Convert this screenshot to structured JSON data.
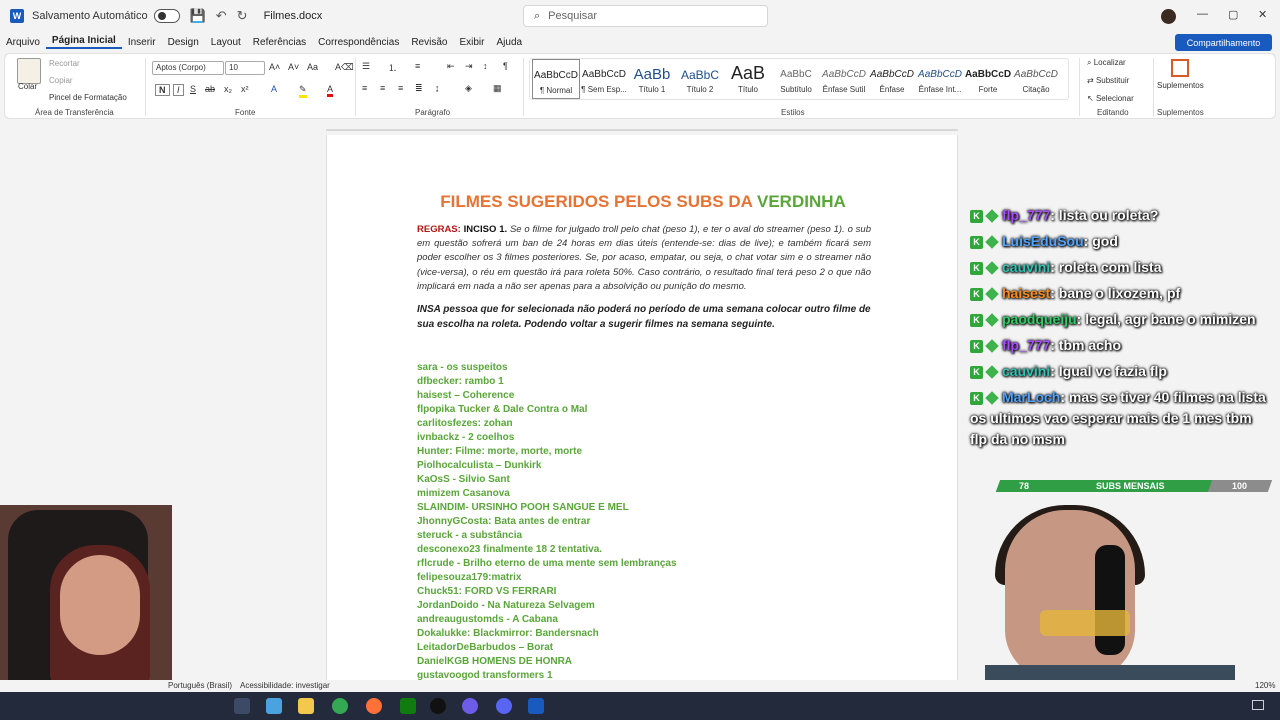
{
  "titlebar": {
    "autosave_label": "Salvamento Automático",
    "filename": "Filmes.docx",
    "search_placeholder": "Pesquisar"
  },
  "ribbon_tabs": [
    "Arquivo",
    "Página Inicial",
    "Inserir",
    "Design",
    "Layout",
    "Referências",
    "Correspondências",
    "Revisão",
    "Exibir",
    "Ajuda"
  ],
  "share_label": "Compartilhamento",
  "clipboard": {
    "paste": "Colar",
    "cut": "Recortar",
    "copy": "Copiar",
    "format_painter": "Pincel de Formatação",
    "group": "Área de Transferência"
  },
  "font": {
    "family": "Aptos (Corpo)",
    "size": "10",
    "group": "Fonte"
  },
  "paragraph_group": "Parágrafo",
  "styles": {
    "group": "Estilos",
    "items": [
      {
        "preview": "AaBbCcD",
        "name": "¶ Normal"
      },
      {
        "preview": "AaBbCcD",
        "name": "¶ Sem Esp..."
      },
      {
        "preview": "AaBb",
        "name": "Título 1"
      },
      {
        "preview": "AaBbC",
        "name": "Título 2"
      },
      {
        "preview": "AaB",
        "name": "Título"
      },
      {
        "preview": "AaBbC",
        "name": "Subtítulo"
      },
      {
        "preview": "AaBbCcD",
        "name": "Ênfase Sutil"
      },
      {
        "preview": "AaBbCcD",
        "name": "Ênfase"
      },
      {
        "preview": "AaBbCcD",
        "name": "Ênfase Int..."
      },
      {
        "preview": "AaBbCcD",
        "name": "Forte"
      },
      {
        "preview": "AaBbCcD",
        "name": "Citação"
      }
    ]
  },
  "editing": {
    "find": "Localizar",
    "replace": "Substituir",
    "select": "Selecionar",
    "group": "Editando"
  },
  "addins": {
    "label": "Suplementos",
    "group": "Suplementos"
  },
  "document": {
    "title_main": "FILMES SUGERIDOS PELOS SUBS DA",
    "title_accent": "VERDINHA",
    "rules_label": "REGRAS:",
    "rules_clause": "INCISO 1.",
    "rules_text": "Se o filme for julgado troll pelo chat (peso 1), e ter o aval do streamer (peso 1). o sub em questão sofrerá um ban de 24 horas em dias úteis (entende-se: dias de live); e também ficará sem poder escolher os 3 filmes posteriores. Se, por acaso, empatar, ou seja, o chat votar sim e o streamer não (vice-versa), o réu em questão irá para roleta 50%. Caso contrário, o resultado final terá peso 2 o que não implicará em nada a não ser apenas para a absolvição ou punição do mesmo.",
    "rule2": "INSA pessoa que for selecionada não poderá no período de uma semana colocar outro filme de sua escolha na roleta. Podendo voltar a sugerir filmes na semana seguinte.",
    "list": [
      "sara - os suspeitos",
      "dfbecker: rambo 1",
      "haisest – Coherence",
      "flpopika Tucker & Dale Contra o Mal",
      "carlitosfezes: zohan",
      "ivnbackz - 2 coelhos",
      "Hunter: Filme: morte, morte, morte",
      " Piolhocalculista – Dunkirk",
      "KaOsS - Silvio Sant",
      "mimizem Casanova",
      "SLAINDIM- URSINHO POOH SANGUE E MEL",
      "JhonnyGCosta: Bata antes de entrar",
      "steruck - a substância",
      "desconexo23 finalmente 18 2 tentativa.",
      "rflcrude - Brilho eterno de uma mente sem lembranças",
      "felipesouza179:matrix",
      "Chuck51: FORD VS FERRARI",
      "JordanDoido - Na Natureza Selvagem",
      "andreaugustomds - A Cabana",
      "Dokalukke: Blackmirror: Bandersnach",
      "LeitadorDeBarbudos – Borat",
      "DanielKGB HOMENS DE HONRA",
      "gustavoogod transformers 1"
    ]
  },
  "chat": [
    {
      "user": "flp_777",
      "text": ": lista ou roleta?",
      "color": "#a64bff"
    },
    {
      "user": "LuisEduSou",
      "text": ": god",
      "color": "#4fa3ff"
    },
    {
      "user": "cauvini",
      "text": ": roleta com lista",
      "color": "#2ec4b6"
    },
    {
      "user": "haisest",
      "text": ": bane o lixozem, pf",
      "color": "#ff8c1a"
    },
    {
      "user": "paodqueiju",
      "text": ": legal, agr bane o mimizen",
      "color": "#33cc66"
    },
    {
      "user": "flp_777",
      "text": ": tbm acho",
      "color": "#a64bff"
    },
    {
      "user": "cauvini",
      "text": ": Igual vc fazia flp",
      "color": "#2ec4b6"
    },
    {
      "user": "MarLoch",
      "text": ": mas se tiver 40 filmes na lista os ultimos vao esperar mais de 1 mes tbm flp da no msm",
      "color": "#4fa3ff"
    }
  ],
  "subs": {
    "current": "78",
    "label": "SUBS MENSAIS",
    "goal": "100",
    "fraction": 0.78
  },
  "statusbar": {
    "language": "Português (Brasil)",
    "accessibility": "Acessibilidade: investigar",
    "zoom": "120%"
  }
}
